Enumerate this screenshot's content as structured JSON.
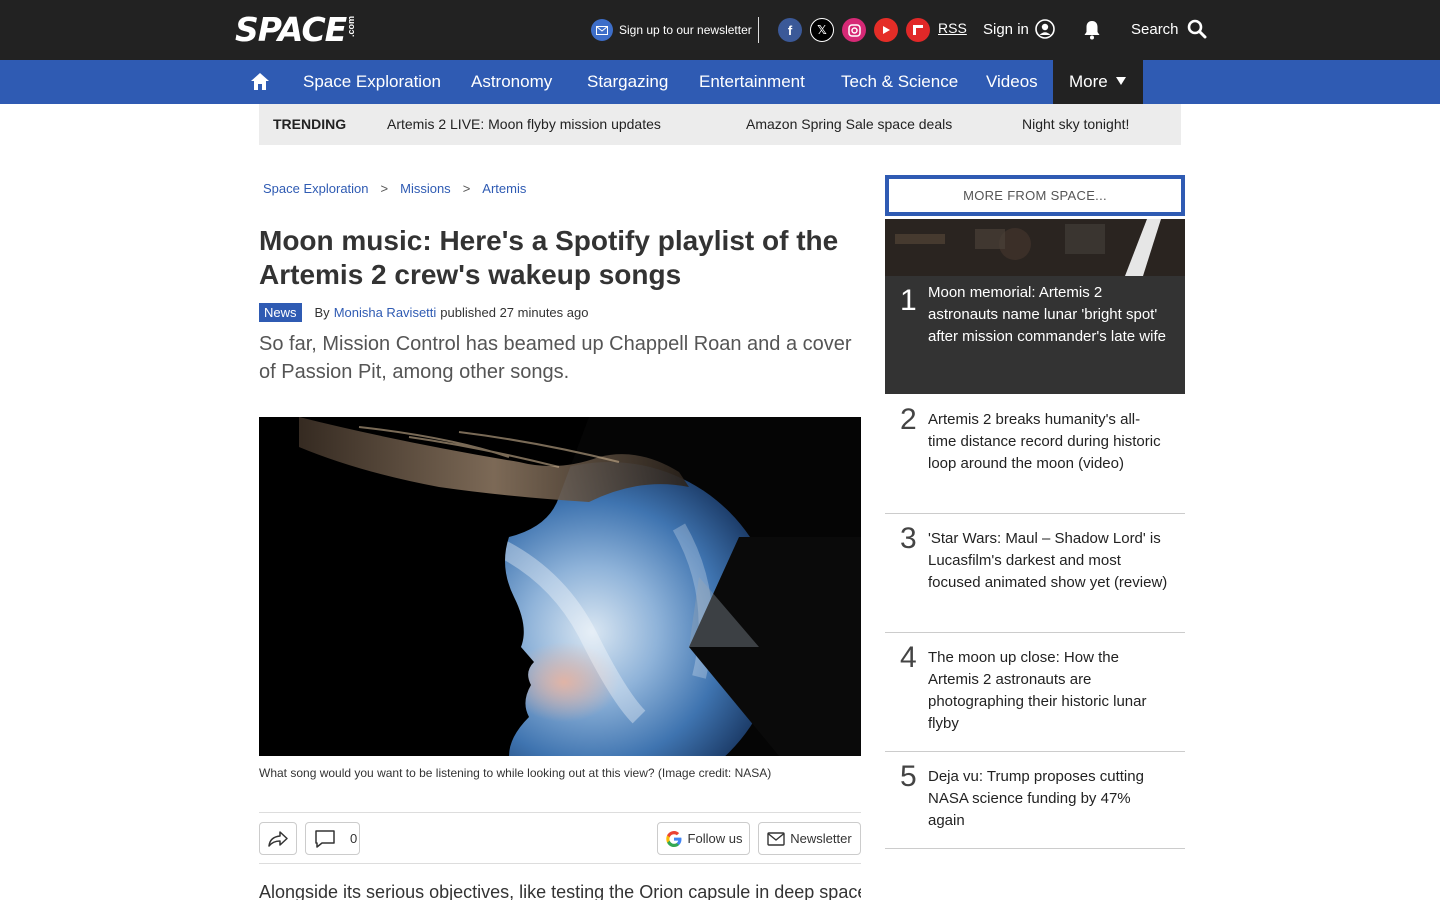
{
  "header": {
    "logo_text": "SPACE",
    "logo_suffix": ".com",
    "newsletter_label": "Sign up to our newsletter",
    "rss_label": "RSS",
    "signin_label": "Sign in",
    "search_label": "Search"
  },
  "nav": {
    "items": [
      "Space Exploration",
      "Astronomy",
      "Stargazing",
      "Entertainment",
      "Tech & Science",
      "Videos"
    ],
    "more_label": "More"
  },
  "trending": {
    "label": "TRENDING",
    "items": [
      "Artemis 2 LIVE: Moon flyby mission updates",
      "Amazon Spring Sale space deals",
      "Night sky tonight!"
    ]
  },
  "breadcrumb": [
    "Space Exploration",
    "Missions",
    "Artemis"
  ],
  "article": {
    "title": "Moon music: Here's a Spotify playlist of the Artemis 2 crew's wakeup songs",
    "tag": "News",
    "by": "By",
    "author": "Monisha Ravisetti",
    "published": "published 27 minutes ago",
    "standfirst": "So far, Mission Control has beamed up Chappell Roan and a cover of Passion Pit, among other songs.",
    "caption": "What song would you want to be listening to while looking out at this view? (Image credit: NASA)",
    "comment_count": "0",
    "follow_label": "Follow us",
    "newsletter_label": "Newsletter",
    "body_start": "Alongside its serious objectives, like testing the Orion capsule in deep space,"
  },
  "sidebar": {
    "heading": "MORE FROM SPACE...",
    "items": [
      {
        "num": "1",
        "text": "Moon memorial: Artemis 2 astronauts name lunar 'bright spot' after mission commander's late wife"
      },
      {
        "num": "2",
        "text": "Artemis 2 breaks humanity's all-time distance record during historic loop around the moon (video)"
      },
      {
        "num": "3",
        "text": "'Star Wars: Maul – Shadow Lord' is Lucasfilm's darkest and most focused animated show yet (review)"
      },
      {
        "num": "4",
        "text": "The moon up close: How the Artemis 2 astronauts are photographing their historic lunar flyby"
      },
      {
        "num": "5",
        "text": "Deja vu: Trump proposes cutting NASA science funding by 47% again"
      }
    ]
  },
  "colors": {
    "topbar": "#222222",
    "nav": "#2f5bb3",
    "accent": "#2f5bb3"
  }
}
